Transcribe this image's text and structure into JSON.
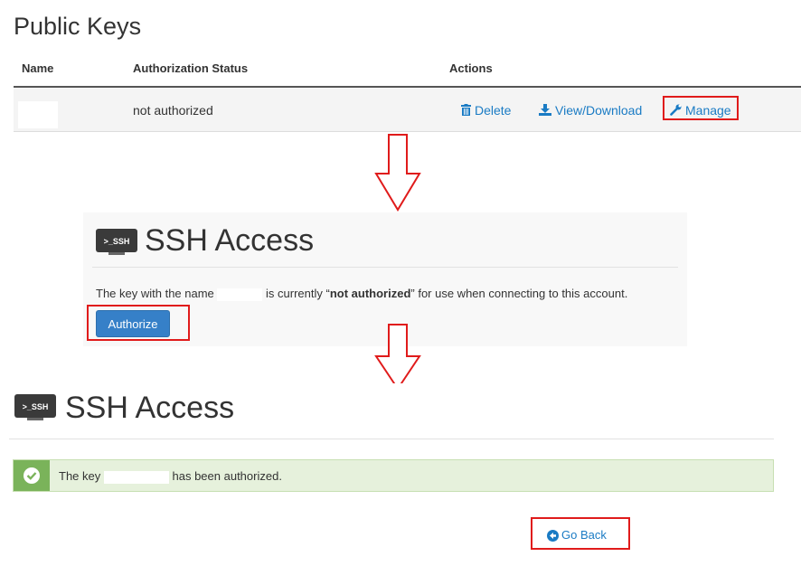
{
  "public_keys": {
    "title": "Public Keys",
    "columns": [
      "Name",
      "Authorization Status",
      "Actions"
    ],
    "row": {
      "status": "not authorized",
      "actions": {
        "delete": "Delete",
        "view_download": "View/Download",
        "manage": "Manage"
      }
    }
  },
  "ssh_access_prompt": {
    "title": "SSH Access",
    "logo_text": ">_SSH",
    "message_before": "The key with the name",
    "message_mid": "is currently “",
    "message_bold": "not authorized",
    "message_after": "” for use when connecting to this account.",
    "authorize_button": "Authorize"
  },
  "ssh_access_result": {
    "title": "SSH Access",
    "logo_text": ">_SSH",
    "alert_before": "The key",
    "alert_after": "has been authorized.",
    "go_back": "Go Back"
  },
  "colors": {
    "link": "#1a7bc4",
    "highlight_red": "#e01b1b",
    "button_blue": "#3680c8",
    "success_green": "#7ab35a"
  }
}
